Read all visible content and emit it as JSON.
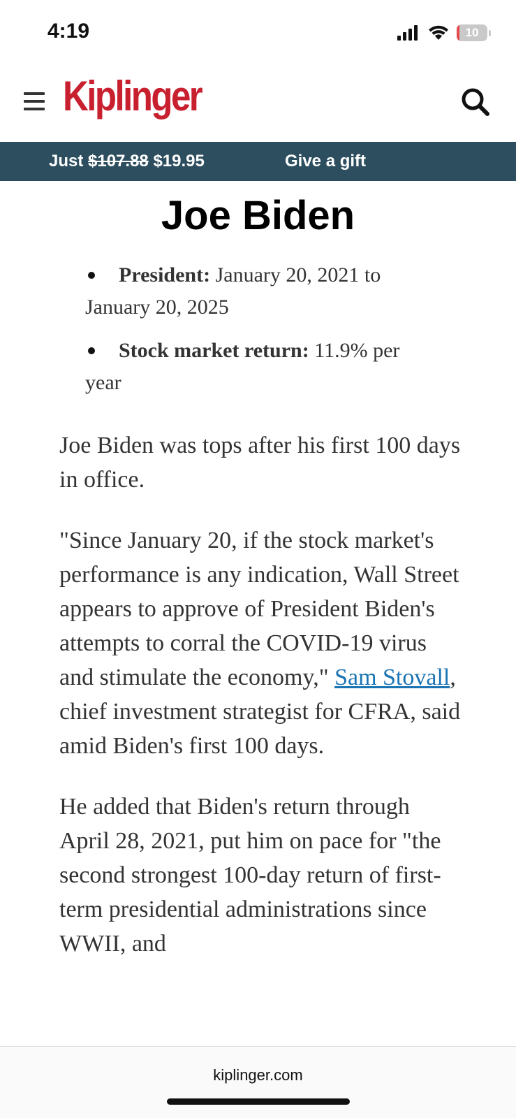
{
  "status_bar": {
    "time": "4:19",
    "battery_level": "10",
    "battery_fraction": 0.1
  },
  "header": {
    "logo": "Kiplinger",
    "brand_color": "#c8202f",
    "menu_icon": "hamburger-menu-icon",
    "search_icon": "search-icon"
  },
  "promo": {
    "prefix": "Just ",
    "old_price": "$107.88",
    "new_price": "$19.95",
    "gift": "Give a gift",
    "background": "#2c4e5f"
  },
  "article": {
    "heading": "Joe Biden",
    "facts": [
      {
        "label": "President:",
        "value": "January 20, 2021 to January 20, 2025"
      },
      {
        "label": "Stock market return:",
        "value": "11.9% per year"
      }
    ],
    "paragraphs": {
      "p1": "Joe Biden was tops after his first 100 days in office.",
      "p2_before": "\"Since January 20, if the stock market's performance is any indication, Wall Street appears to approve of President Biden's attempts to corral the COVID-19 virus and stimulate the economy,\" ",
      "p2_link": "Sam Stovall",
      "p2_after": ", chief investment strategist for CFRA, said amid Biden's first 100 days.",
      "p3": "He added that Biden's return through April 28, 2021, put him on pace for \"the second strongest 100-day return of first-term presidential administrations since WWII, and"
    },
    "link_color": "#1a74b3"
  },
  "url_bar": {
    "domain": "kiplinger.com"
  }
}
